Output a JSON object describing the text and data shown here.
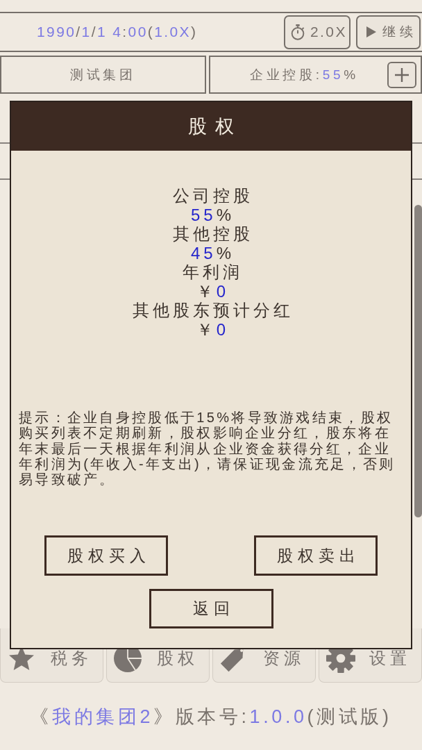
{
  "top_bar": {
    "datetime": [
      {
        "text": "1990",
        "kind": "accent"
      },
      {
        "text": "/",
        "kind": "plain"
      },
      {
        "text": "1",
        "kind": "accent"
      },
      {
        "text": "/",
        "kind": "plain"
      },
      {
        "text": "1 4",
        "kind": "accent"
      },
      {
        "text": ":",
        "kind": "plain"
      },
      {
        "text": "00",
        "kind": "accent"
      },
      {
        "text": "(",
        "kind": "plain"
      },
      {
        "text": "1.0X",
        "kind": "accent"
      },
      {
        "text": ")",
        "kind": "plain"
      }
    ],
    "speed_button": {
      "label": "2.0X"
    },
    "continue_button": {
      "label": "继续"
    }
  },
  "company_row": {
    "company_name": "测试集团",
    "holding": [
      {
        "text": "企业控股:",
        "kind": "plain"
      },
      {
        "text": "55",
        "kind": "accent"
      },
      {
        "text": "%",
        "kind": "plain"
      }
    ]
  },
  "dialog": {
    "title": "股权",
    "stats": [
      {
        "label": "公司控股",
        "value": [
          {
            "text": "55",
            "kind": "accent"
          },
          {
            "text": "%",
            "kind": "plain"
          }
        ]
      },
      {
        "label": "其他控股",
        "value": [
          {
            "text": "45",
            "kind": "accent"
          },
          {
            "text": "%",
            "kind": "plain"
          }
        ]
      },
      {
        "label": "年利润",
        "value": [
          {
            "text": "￥",
            "kind": "plain"
          },
          {
            "text": "0",
            "kind": "accent"
          }
        ]
      },
      {
        "label": "其他股东预计分红",
        "value": [
          {
            "text": "￥",
            "kind": "plain"
          },
          {
            "text": "0",
            "kind": "accent"
          }
        ]
      }
    ],
    "hint": "提示：企业自身控股低于15%将导致游戏结束，股权购买列表不定期刷新，股权影响企业分红，股东将在年末最后一天根据年利润从企业资金获得分红，企业年利润为(年收入-年支出)，请保证现金流充足，否则易导致破产。",
    "buttons": [
      {
        "label": "股权买入"
      },
      {
        "label": "股权卖出"
      },
      {
        "label": "返回"
      }
    ]
  },
  "bottom_nav": [
    {
      "label": "税务"
    },
    {
      "label": "股权"
    },
    {
      "label": "资源"
    },
    {
      "label": "设置"
    }
  ],
  "footer": {
    "version_line": [
      {
        "text": "《",
        "kind": "plain"
      },
      {
        "text": "我的集团2",
        "kind": "accent"
      },
      {
        "text": "》版本号:",
        "kind": "plain"
      },
      {
        "text": "1.0.0",
        "kind": "accent"
      },
      {
        "text": "(测试版)",
        "kind": "plain"
      }
    ]
  }
}
